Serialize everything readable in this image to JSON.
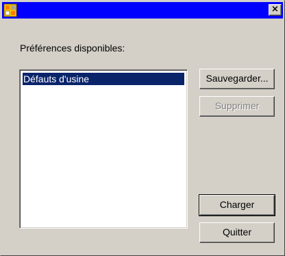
{
  "titlebar": {
    "title": "",
    "app_icon": "app-icon",
    "close_label": "×",
    "colors": {
      "titlebar": "#0000ff"
    }
  },
  "dialog": {
    "label": "Préférences disponibles:",
    "list_items": [
      {
        "label": "Défauts d'usine",
        "selected": true
      }
    ],
    "buttons": {
      "save": "Sauvegarder...",
      "delete": "Supprimer",
      "load": "Charger",
      "quit": "Quitter"
    },
    "colors": {
      "window_bg": "#d4d0c8",
      "selection_bg": "#0a246a",
      "disabled_text": "#808080"
    }
  }
}
